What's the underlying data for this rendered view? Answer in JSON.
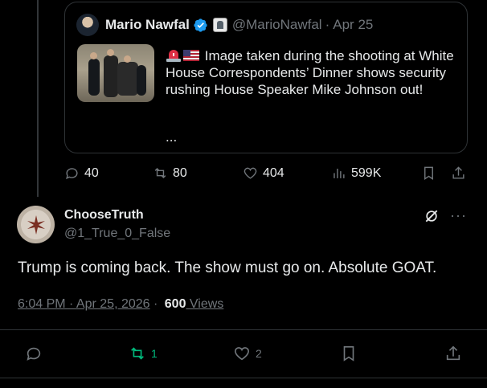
{
  "quoted_tweet": {
    "author_name": "Mario Nawfal",
    "handle": "@MarioNawfal",
    "separator": "·",
    "date": "Apr 25",
    "text": "Image taken during the shooting at White House Correspondents’ Dinner shows security rushing House Speaker Mike Johnson out!",
    "ellipsis": "...",
    "emoji_icons": [
      "rotating-light-icon",
      "us-flag-icon"
    ],
    "actions": {
      "replies": "40",
      "reposts": "80",
      "likes": "404",
      "views": "599K"
    }
  },
  "tweet": {
    "author_name": "ChooseTruth",
    "handle": "@1_True_0_False",
    "text": "Trump is coming back. The show must go on. Absolute GOAT.",
    "time": "6:04 PM · Apr 25, 2026",
    "meta_sep": " · ",
    "views_count": "600",
    "views_label": " Views",
    "more_label": "···",
    "actions": {
      "reposts": "1",
      "likes": "2"
    }
  },
  "colors": {
    "background": "#000000",
    "text": "#e7e9ea",
    "muted": "#71767b",
    "border": "#2f3336",
    "verified": "#1d9bf0",
    "repost_active": "#00ba7c"
  }
}
